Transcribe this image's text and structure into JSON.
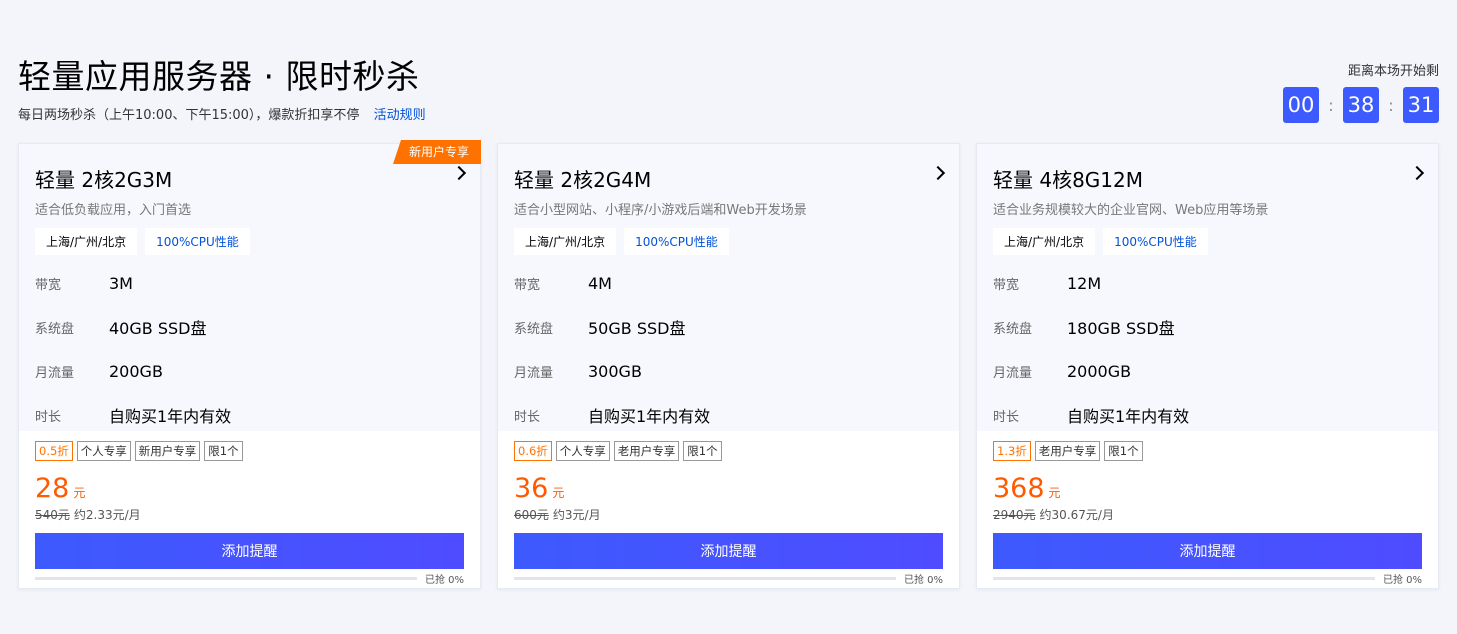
{
  "header": {
    "title": "轻量应用服务器 · 限时秒杀",
    "subtitle": "每日两场秒杀（上午10:00、下午15:00），爆款折扣享不停",
    "rules_link": "活动规则"
  },
  "countdown": {
    "label": "距离本场开始剩",
    "hours": "00",
    "minutes": "38",
    "seconds": "31",
    "separator": ":"
  },
  "colors": {
    "accent": "#3d5afe",
    "price": "#ff5a00",
    "badge": "#ff7200",
    "link": "#0052d9"
  },
  "cards": [
    {
      "name": "轻量 2核2G3M",
      "desc": "适合低负载应用，入门首选",
      "badge": "新用户专享",
      "region_tag": "上海/广州/北京",
      "cpu_tag": "100%CPU性能",
      "specs": [
        {
          "label": "带宽",
          "value": "3M"
        },
        {
          "label": "系统盘",
          "value": "40GB SSD盘"
        },
        {
          "label": "月流量",
          "value": "200GB"
        },
        {
          "label": "时长",
          "value": "自购买1年内有效"
        }
      ],
      "discount": "0.5折",
      "promo_tags": [
        "个人专享",
        "新用户专享",
        "限1个"
      ],
      "price": "28",
      "price_unit": "元",
      "original_price": "540元",
      "monthly": "约2.33元/月",
      "button": "添加提醒",
      "progress_text": "已抢 0%",
      "progress": 0
    },
    {
      "name": "轻量 2核2G4M",
      "desc": "适合小型网站、小程序/小游戏后端和Web开发场景",
      "badge": "",
      "region_tag": "上海/广州/北京",
      "cpu_tag": "100%CPU性能",
      "specs": [
        {
          "label": "带宽",
          "value": "4M"
        },
        {
          "label": "系统盘",
          "value": "50GB SSD盘"
        },
        {
          "label": "月流量",
          "value": "300GB"
        },
        {
          "label": "时长",
          "value": "自购买1年内有效"
        }
      ],
      "discount": "0.6折",
      "promo_tags": [
        "个人专享",
        "老用户专享",
        "限1个"
      ],
      "price": "36",
      "price_unit": "元",
      "original_price": "600元",
      "monthly": "约3元/月",
      "button": "添加提醒",
      "progress_text": "已抢 0%",
      "progress": 0
    },
    {
      "name": "轻量 4核8G12M",
      "desc": "适合业务规模较大的企业官网、Web应用等场景",
      "badge": "",
      "region_tag": "上海/广州/北京",
      "cpu_tag": "100%CPU性能",
      "specs": [
        {
          "label": "带宽",
          "value": "12M"
        },
        {
          "label": "系统盘",
          "value": "180GB SSD盘"
        },
        {
          "label": "月流量",
          "value": "2000GB"
        },
        {
          "label": "时长",
          "value": "自购买1年内有效"
        }
      ],
      "discount": "1.3折",
      "promo_tags": [
        "老用户专享",
        "限1个"
      ],
      "price": "368",
      "price_unit": "元",
      "original_price": "2940元",
      "monthly": "约30.67元/月",
      "button": "添加提醒",
      "progress_text": "已抢 0%",
      "progress": 0
    }
  ]
}
